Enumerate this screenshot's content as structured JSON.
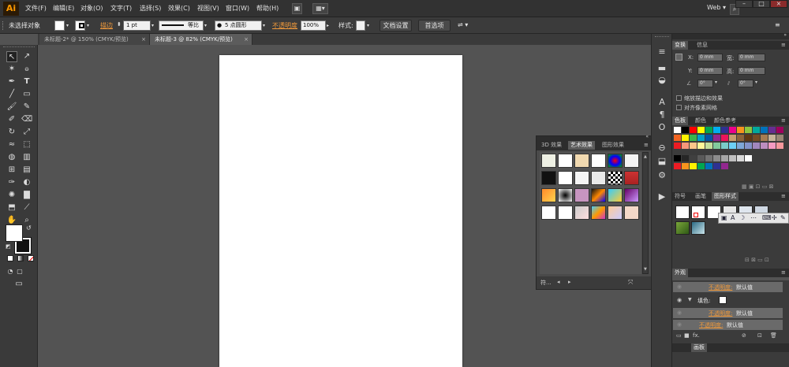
{
  "app": {
    "logo": "Ai",
    "workspace": "Web",
    "window_controls": [
      "–",
      "□",
      "×"
    ]
  },
  "menu": [
    "文件(F)",
    "编辑(E)",
    "对象(O)",
    "文字(T)",
    "选择(S)",
    "效果(C)",
    "视图(V)",
    "窗口(W)",
    "帮助(H)"
  ],
  "control_bar": {
    "selection_status": "未选择对象",
    "stroke_label": "描边",
    "stroke_weight": "1 pt",
    "stroke_style": "等比",
    "brush": "5 点圆形",
    "opacity_label": "不透明度",
    "opacity_value": "100%",
    "style_label": "样式:",
    "doc_setup_button": "文档设置",
    "preferences_button": "首选项"
  },
  "document_tabs": [
    {
      "label": "未标题-2* @ 150% (CMYK/预览)",
      "active": false
    },
    {
      "label": "未标题-3 @ 82% (CMYK/预览)",
      "active": true
    }
  ],
  "transform_panel": {
    "tabs": [
      "变换",
      "信息"
    ],
    "x_label": "X:",
    "x_value": "0 mm",
    "y_label": "Y:",
    "y_value": "0 mm",
    "w_label": "宽:",
    "w_value": "0 mm",
    "h_label": "高:",
    "h_value": "0 mm",
    "angle_value": "0°",
    "shear_value": "0°",
    "scale_strokes": "缩放描边和效果",
    "align_pixel": "对齐像素网格"
  },
  "swatches_panel": {
    "tabs": [
      "色板",
      "颜色",
      "颜色参考"
    ],
    "row1": [
      "#ffffff",
      "#000000",
      "#ff0000",
      "#ffff00",
      "#00a651",
      "#00aeef",
      "#2e3192",
      "#ec008c",
      "#f7941d",
      "#8dc63f",
      "#00a99d",
      "#0072bc",
      "#662d91",
      "#9e005d"
    ],
    "row2": [
      "#f26522",
      "#fff200",
      "#39b54a",
      "#00a0c6",
      "#0054a6",
      "#92278f",
      "#ed145b",
      "#c69c6d",
      "#8c6239",
      "#603813",
      "#754c24",
      "#a67c52",
      "#c7b299",
      "#998675"
    ],
    "row3": [
      "#ed1c24",
      "#f7977a",
      "#fdc689",
      "#fff799",
      "#c4df9b",
      "#82ca9c",
      "#7accc8",
      "#6dcff6",
      "#7ea7d8",
      "#8493ca",
      "#a187be",
      "#bc8dbf",
      "#f49ac2",
      "#f5989d"
    ],
    "row4": [
      "#000000",
      "#262626",
      "#404040",
      "#595959",
      "#737373",
      "#8c8c8c",
      "#a6a6a6",
      "#bfbfbf",
      "#d9d9d9",
      "#ffffff"
    ],
    "row5": [
      "#ed1c24",
      "#f7941d",
      "#fff200",
      "#00a651",
      "#0072bc",
      "#2e3192",
      "#92278f"
    ]
  },
  "graphic_styles_panel": {
    "tabs": [
      "符号",
      "画笔",
      "图形样式"
    ]
  },
  "appearance_panel": {
    "title": "外观",
    "rows": [
      {
        "label": "不透明度:",
        "value": "默认值",
        "type": "opacity"
      },
      {
        "label": "填色:",
        "value": "",
        "type": "fill"
      },
      {
        "label": "不透明度:",
        "value": "默认值",
        "type": "opacity"
      },
      {
        "label": "不透明度:",
        "value": "默认值",
        "type": "opacity"
      }
    ],
    "footer_label": "fx."
  },
  "artboards_tab": "画板",
  "art_effects_panel": {
    "tabs": [
      "3D 效果",
      "艺术效果",
      "图形效果"
    ],
    "footer_label": "符..."
  },
  "colors": {
    "accent_orange": "#f19a3b",
    "app_bg": "#535353",
    "panel_bg": "#3b3b3b",
    "artboard": "#ffffff"
  }
}
